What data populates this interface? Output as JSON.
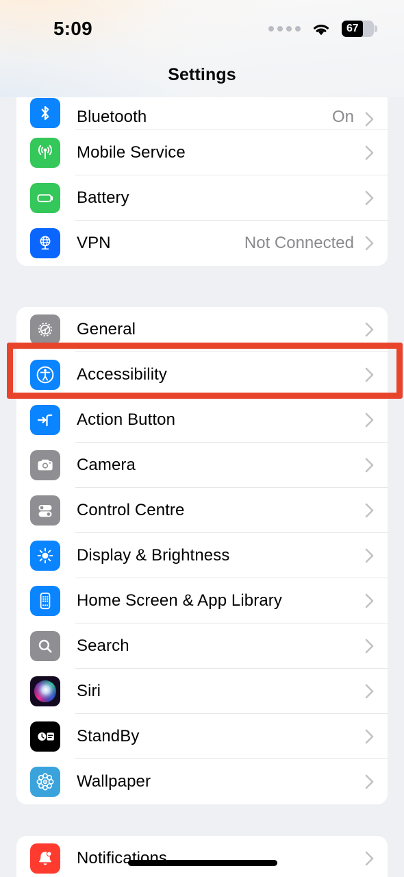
{
  "status_bar": {
    "time": "5:09",
    "cellular_icon": "signal-dots-icon",
    "wifi_icon": "wifi-icon",
    "battery_icon": "battery-icon",
    "battery_percent": "67",
    "battery_level": 67
  },
  "nav": {
    "title": "Settings"
  },
  "highlight": {
    "color": "#e8442c",
    "target": "Accessibility"
  },
  "sections": [
    {
      "id": "connectivity",
      "clipped_top": true,
      "rows": [
        {
          "label": "Bluetooth",
          "value": "On",
          "icon": "bluetooth-icon",
          "icon_color": "#0a84ff",
          "partial": true
        },
        {
          "label": "Mobile Service",
          "value": "",
          "icon": "cellular-antenna-icon",
          "icon_color": "#34c759"
        },
        {
          "label": "Battery",
          "value": "",
          "icon": "battery-icon",
          "icon_color": "#34c759"
        },
        {
          "label": "VPN",
          "value": "Not Connected",
          "icon": "globe-vpn-icon",
          "icon_color": "#0a66ff"
        }
      ]
    },
    {
      "id": "system",
      "rows": [
        {
          "label": "General",
          "value": "",
          "icon": "gear-icon",
          "icon_color": "#8e8e93"
        },
        {
          "label": "Accessibility",
          "value": "",
          "icon": "accessibility-icon",
          "icon_color": "#0a84ff"
        },
        {
          "label": "Action Button",
          "value": "",
          "icon": "action-button-icon",
          "icon_color": "#0a84ff"
        },
        {
          "label": "Camera",
          "value": "",
          "icon": "camera-icon",
          "icon_color": "#8e8e93"
        },
        {
          "label": "Control Centre",
          "value": "",
          "icon": "control-centre-icon",
          "icon_color": "#8e8e93"
        },
        {
          "label": "Display & Brightness",
          "value": "",
          "icon": "brightness-sun-icon",
          "icon_color": "#0a84ff"
        },
        {
          "label": "Home Screen & App Library",
          "value": "",
          "icon": "home-screen-icon",
          "icon_color": "#0a84ff"
        },
        {
          "label": "Search",
          "value": "",
          "icon": "search-icon",
          "icon_color": "#8e8e93"
        },
        {
          "label": "Siri",
          "value": "",
          "icon": "siri-orb-icon",
          "icon_color": "#1a1030"
        },
        {
          "label": "StandBy",
          "value": "",
          "icon": "standby-icon",
          "icon_color": "#000000"
        },
        {
          "label": "Wallpaper",
          "value": "",
          "icon": "wallpaper-flower-icon",
          "icon_color": "#3ba3dc"
        }
      ]
    },
    {
      "id": "notifications",
      "clipped_bottom": true,
      "rows": [
        {
          "label": "Notifications",
          "value": "",
          "icon": "notifications-bell-icon",
          "icon_color": "#ff3b30"
        }
      ]
    }
  ]
}
